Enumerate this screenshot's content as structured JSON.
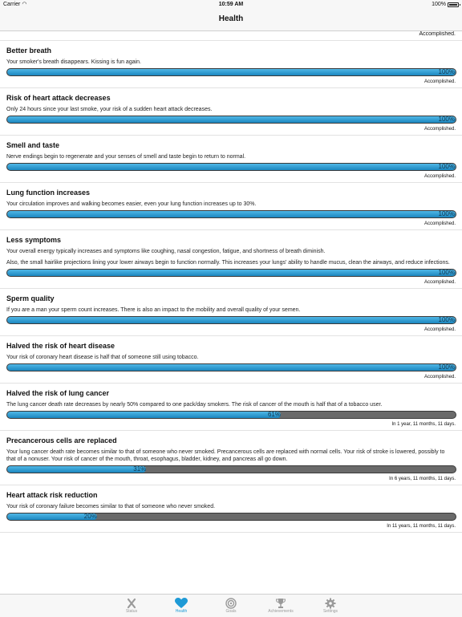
{
  "status_bar": {
    "carrier": "Carrier",
    "time": "10:59 AM",
    "battery": "100%"
  },
  "nav": {
    "title": "Health"
  },
  "top_status": "Accomplished.",
  "items": [
    {
      "title": "Better breath",
      "desc": [
        "Your smoker's breath disappears. Kissing is fun again."
      ],
      "progress": 100,
      "progress_label": "100%",
      "status": "Accomplished."
    },
    {
      "title": "Risk of heart attack decreases",
      "desc": [
        "Only 24 hours since your last smoke, your risk of a sudden heart attack decreases."
      ],
      "progress": 100,
      "progress_label": "100%",
      "status": "Accomplished."
    },
    {
      "title": "Smell and taste",
      "desc": [
        "Nerve endings begin to regenerate and your senses of smell and taste begin to return to normal."
      ],
      "progress": 100,
      "progress_label": "100%",
      "status": "Accomplished."
    },
    {
      "title": "Lung function increases",
      "desc": [
        "Your circulation improves and walking becomes easier, even your lung function increases up to 30%."
      ],
      "progress": 100,
      "progress_label": "100%",
      "status": "Accomplished."
    },
    {
      "title": "Less symptoms",
      "desc": [
        "Your overall energy typically increases and symptoms like coughing, nasal congestion, fatigue, and shortness of breath diminish.",
        "Also, the small hairlike projections lining your lower airways begin to function normally. This increases your lungs' ability to handle mucus, clean the airways, and reduce infections."
      ],
      "progress": 100,
      "progress_label": "100%",
      "status": "Accomplished."
    },
    {
      "title": "Sperm quality",
      "desc": [
        "If you are a man your sperm count increases. There is also an impact to the mobility and overall quality of your semen."
      ],
      "progress": 100,
      "progress_label": "100%",
      "status": "Accomplished."
    },
    {
      "title": "Halved the risk of heart disease",
      "desc": [
        "Your risk of coronary heart disease is half that of someone still using tobacco."
      ],
      "progress": 100,
      "progress_label": "100%",
      "status": "Accomplished."
    },
    {
      "title": "Halved the risk of lung cancer",
      "desc": [
        "The lung cancer death rate decreases by nearly 50% compared to one pack/day smokers. The risk of cancer of the mouth is half that of a tobacco user."
      ],
      "progress": 61,
      "progress_label": "61%",
      "status": "In 1 year, 11 months, 11 days."
    },
    {
      "title": "Precancerous cells are replaced",
      "desc": [
        "Your lung cancer death rate becomes similar to that of someone who never smoked. Precancerous cells are replaced with normal cells. Your risk of stroke is lowered, possibly to that of a nonuser. Your risk of cancer of the mouth, throat, esophagus, bladder, kidney, and pancreas all go down."
      ],
      "progress": 31,
      "progress_label": "31%",
      "status": "In 6 years, 11 months, 11 days."
    },
    {
      "title": "Heart attack risk reduction",
      "desc": [
        "Your risk of coronary failure becomes similar to that of someone who never smoked."
      ],
      "progress": 20,
      "progress_label": "20%",
      "status": "In 11 years, 11 months, 11 days."
    }
  ],
  "tabs": [
    {
      "label": "Status",
      "icon": "x-mark-icon",
      "active": false
    },
    {
      "label": "Health",
      "icon": "heart-icon",
      "active": true
    },
    {
      "label": "Goals",
      "icon": "target-icon",
      "active": false
    },
    {
      "label": "Achievements",
      "icon": "trophy-icon",
      "active": false
    },
    {
      "label": "Settings",
      "icon": "gear-icon",
      "active": false
    }
  ],
  "colors": {
    "accent": "#1e9ad6",
    "bar_fill": "#2a9fd6",
    "bar_track": "#6a6a6a"
  }
}
